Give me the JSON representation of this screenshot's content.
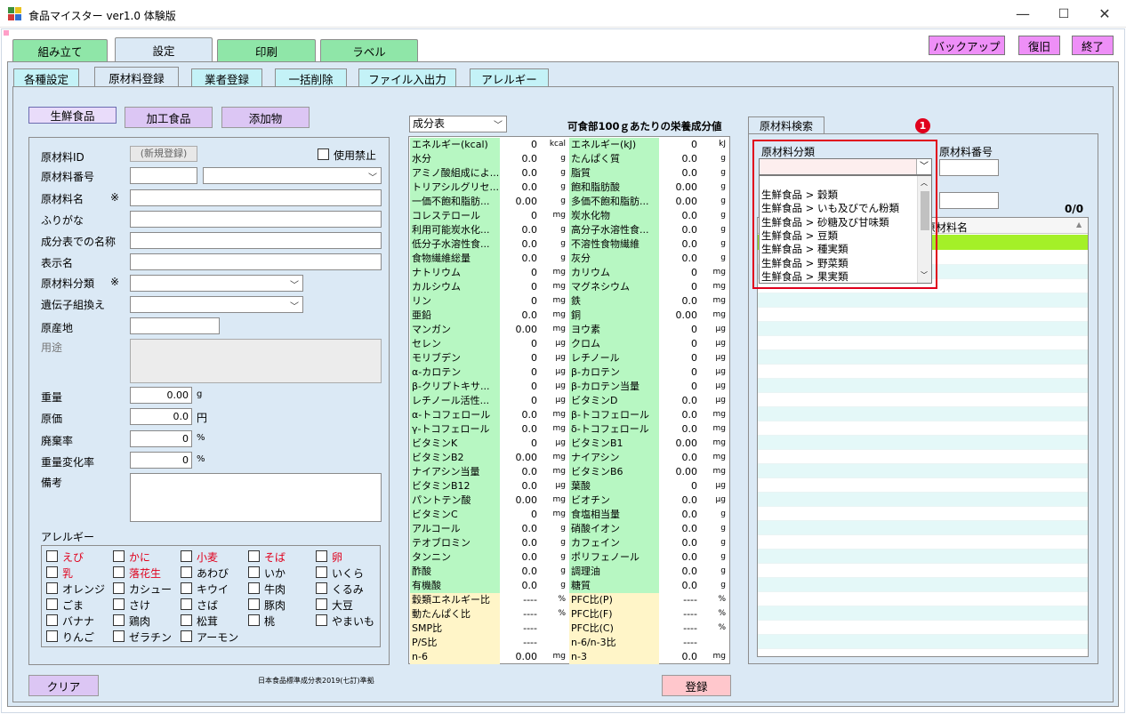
{
  "window": {
    "title": "食品マイスター ver1.0 体験版",
    "min": "—",
    "max": "☐",
    "close": "✕"
  },
  "main_tabs": [
    "組み立て",
    "設定",
    "印刷",
    "ラベル"
  ],
  "top_buttons": {
    "backup": "バックアップ",
    "restore": "復旧",
    "exit": "終了"
  },
  "sub_tabs": [
    "各種設定",
    "原材料登録",
    "業者登録",
    "一括削除",
    "ファイル入出力",
    "アレルギー"
  ],
  "category_buttons": [
    "生鮮食品",
    "加工食品",
    "添加物"
  ],
  "form": {
    "id_label": "原材料ID",
    "id_value": "(新規登録)",
    "disable_label": "使用禁止",
    "number_label": "原材料番号",
    "name_label": "原材料名",
    "required_mark": "※",
    "furigana_label": "ふりがな",
    "component_name_label": "成分表での名称",
    "display_name_label": "表示名",
    "category_label": "原材料分類",
    "gmo_label": "遺伝子組換え",
    "origin_label": "原産地",
    "usage_label": "用途",
    "weight_label": "重量",
    "weight_value": "0.00",
    "weight_unit": "g",
    "price_label": "原価",
    "price_value": "0.0",
    "price_unit": "円",
    "waste_label": "廃棄率",
    "waste_value": "0",
    "waste_unit": "%",
    "weight_change_label": "重量変化率",
    "weight_change_value": "0",
    "weight_change_unit": "%",
    "notes_label": "備考",
    "allergy_label": "アレルギー"
  },
  "allergens": [
    [
      "えび",
      "かに",
      "小麦",
      "そば",
      "卵"
    ],
    [
      "乳",
      "落花生",
      "あわび",
      "いか",
      "いくら"
    ],
    [
      "オレンジ",
      "カシュー",
      "キウイ",
      "牛肉",
      "くるみ"
    ],
    [
      "ごま",
      "さけ",
      "さば",
      "豚肉",
      "大豆"
    ],
    [
      "バナナ",
      "鶏肉",
      "松茸",
      "桃",
      "やまいも"
    ],
    [
      "りんご",
      "ゼラチン",
      "アーモン"
    ]
  ],
  "clear_button": "クリア",
  "source_note": "日本食品標準成分表2019(七訂)準拠",
  "register_button": "登録",
  "nutrition": {
    "table_select": "成分表",
    "heading": "可食部100ｇあたりの栄養成分値",
    "rows": [
      [
        "エネルギー(kcal)",
        "0",
        "kcal",
        "エネルギー(kJ)",
        "0",
        "kJ"
      ],
      [
        "水分",
        "0.0",
        "g",
        "たんぱく質",
        "0.0",
        "g"
      ],
      [
        "アミノ酸組成によ...",
        "0.0",
        "g",
        "脂質",
        "0.0",
        "g"
      ],
      [
        "トリアシルグリセ...",
        "0.0",
        "g",
        "飽和脂肪酸",
        "0.00",
        "g"
      ],
      [
        "一価不飽和脂肪...",
        "0.00",
        "g",
        "多価不飽和脂肪...",
        "0.00",
        "g"
      ],
      [
        "コレステロール",
        "0",
        "mg",
        "炭水化物",
        "0.0",
        "g"
      ],
      [
        "利用可能炭水化...",
        "0.0",
        "g",
        "高分子水溶性食...",
        "0.0",
        "g"
      ],
      [
        "低分子水溶性食...",
        "0.0",
        "g",
        "不溶性食物繊維",
        "0.0",
        "g"
      ],
      [
        "食物繊維総量",
        "0.0",
        "g",
        "灰分",
        "0.0",
        "g"
      ],
      [
        "ナトリウム",
        "0",
        "mg",
        "カリウム",
        "0",
        "mg"
      ],
      [
        "カルシウム",
        "0",
        "mg",
        "マグネシウム",
        "0",
        "mg"
      ],
      [
        "リン",
        "0",
        "mg",
        "鉄",
        "0.0",
        "mg"
      ],
      [
        "亜鉛",
        "0.0",
        "mg",
        "銅",
        "0.00",
        "mg"
      ],
      [
        "マンガン",
        "0.00",
        "mg",
        "ヨウ素",
        "0",
        "μg"
      ],
      [
        "セレン",
        "0",
        "μg",
        "クロム",
        "0",
        "μg"
      ],
      [
        "モリブデン",
        "0",
        "μg",
        "レチノール",
        "0",
        "μg"
      ],
      [
        "α-カロテン",
        "0",
        "μg",
        "β-カロテン",
        "0",
        "μg"
      ],
      [
        "β-クリプトキサ...",
        "0",
        "μg",
        "β-カロテン当量",
        "0",
        "μg"
      ],
      [
        "レチノール活性...",
        "0",
        "μg",
        "ビタミンD",
        "0.0",
        "μg"
      ],
      [
        "α-トコフェロール",
        "0.0",
        "mg",
        "β-トコフェロール",
        "0.0",
        "mg"
      ],
      [
        "γ-トコフェロール",
        "0.0",
        "mg",
        "δ-トコフェロール",
        "0.0",
        "mg"
      ],
      [
        "ビタミンK",
        "0",
        "μg",
        "ビタミンB1",
        "0.00",
        "mg"
      ],
      [
        "ビタミンB2",
        "0.00",
        "mg",
        "ナイアシン",
        "0.0",
        "mg"
      ],
      [
        "ナイアシン当量",
        "0.0",
        "mg",
        "ビタミンB6",
        "0.00",
        "mg"
      ],
      [
        "ビタミンB12",
        "0.0",
        "μg",
        "葉酸",
        "0",
        "μg"
      ],
      [
        "パントテン酸",
        "0.00",
        "mg",
        "ビオチン",
        "0.0",
        "μg"
      ],
      [
        "ビタミンC",
        "0",
        "mg",
        "食塩相当量",
        "0.0",
        "g"
      ],
      [
        "アルコール",
        "0.0",
        "g",
        "硝酸イオン",
        "0.0",
        "g"
      ],
      [
        "テオブロミン",
        "0.0",
        "g",
        "カフェイン",
        "0.0",
        "g"
      ],
      [
        "タンニン",
        "0.0",
        "g",
        "ポリフェノール",
        "0.0",
        "g"
      ],
      [
        "酢酸",
        "0.0",
        "g",
        "調理油",
        "0.0",
        "g"
      ],
      [
        "有機酸",
        "0.0",
        "g",
        "糖質",
        "0.0",
        "g"
      ]
    ],
    "ratio_rows": [
      [
        "穀類エネルギー比",
        "----",
        "%",
        "PFC比(P)",
        "----",
        "%"
      ],
      [
        "動たんぱく比",
        "----",
        "%",
        "PFC比(F)",
        "----",
        "%"
      ],
      [
        "SMP比",
        "----",
        "",
        "PFC比(C)",
        "----",
        "%"
      ],
      [
        "P/S比",
        "----",
        "",
        "n-6/n-3比",
        "----",
        ""
      ],
      [
        "n-6",
        "0.00",
        "mg",
        "n-3",
        "0.0",
        "mg"
      ]
    ]
  },
  "search": {
    "tab": "原材料検索",
    "category_label": "原材料分類",
    "number_label": "原材料番号",
    "count": "0/0",
    "column_name": "原材料名",
    "dropdown_items": [
      "生鮮食品 > 穀類",
      "生鮮食品 > いも及びでん粉類",
      "生鮮食品 > 砂糖及び甘味類",
      "生鮮食品 > 豆類",
      "生鮮食品 > 種実類",
      "生鮮食品 > 野菜類",
      "生鮮食品 > 果実類"
    ],
    "badge": "1"
  }
}
